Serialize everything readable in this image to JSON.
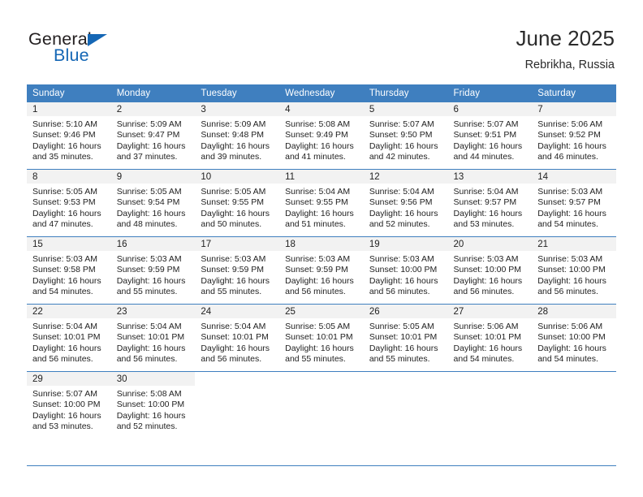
{
  "brand": {
    "word_one": "General",
    "word_two": "Blue",
    "flag_icon": "blue-triangle-flag",
    "accent_color": "#1567b5"
  },
  "header": {
    "title": "June 2025",
    "subtitle": "Rebrikha, Russia"
  },
  "theme": {
    "header_row_bg": "#3f7fbf",
    "daynum_strip_bg": "#f2f2f2",
    "grid_line": "#3f7fbf",
    "text": "#222222"
  },
  "weekdays": [
    "Sunday",
    "Monday",
    "Tuesday",
    "Wednesday",
    "Thursday",
    "Friday",
    "Saturday"
  ],
  "labels": {
    "sunrise_prefix": "Sunrise:",
    "sunset_prefix": "Sunset:",
    "daylight_prefix": "Daylight:"
  },
  "weeks": [
    [
      {
        "day": "1",
        "sunrise": "Sunrise: 5:10 AM",
        "sunset": "Sunset: 9:46 PM",
        "daylight_line1": "Daylight: 16 hours",
        "daylight_line2": "and 35 minutes."
      },
      {
        "day": "2",
        "sunrise": "Sunrise: 5:09 AM",
        "sunset": "Sunset: 9:47 PM",
        "daylight_line1": "Daylight: 16 hours",
        "daylight_line2": "and 37 minutes."
      },
      {
        "day": "3",
        "sunrise": "Sunrise: 5:09 AM",
        "sunset": "Sunset: 9:48 PM",
        "daylight_line1": "Daylight: 16 hours",
        "daylight_line2": "and 39 minutes."
      },
      {
        "day": "4",
        "sunrise": "Sunrise: 5:08 AM",
        "sunset": "Sunset: 9:49 PM",
        "daylight_line1": "Daylight: 16 hours",
        "daylight_line2": "and 41 minutes."
      },
      {
        "day": "5",
        "sunrise": "Sunrise: 5:07 AM",
        "sunset": "Sunset: 9:50 PM",
        "daylight_line1": "Daylight: 16 hours",
        "daylight_line2": "and 42 minutes."
      },
      {
        "day": "6",
        "sunrise": "Sunrise: 5:07 AM",
        "sunset": "Sunset: 9:51 PM",
        "daylight_line1": "Daylight: 16 hours",
        "daylight_line2": "and 44 minutes."
      },
      {
        "day": "7",
        "sunrise": "Sunrise: 5:06 AM",
        "sunset": "Sunset: 9:52 PM",
        "daylight_line1": "Daylight: 16 hours",
        "daylight_line2": "and 46 minutes."
      }
    ],
    [
      {
        "day": "8",
        "sunrise": "Sunrise: 5:05 AM",
        "sunset": "Sunset: 9:53 PM",
        "daylight_line1": "Daylight: 16 hours",
        "daylight_line2": "and 47 minutes."
      },
      {
        "day": "9",
        "sunrise": "Sunrise: 5:05 AM",
        "sunset": "Sunset: 9:54 PM",
        "daylight_line1": "Daylight: 16 hours",
        "daylight_line2": "and 48 minutes."
      },
      {
        "day": "10",
        "sunrise": "Sunrise: 5:05 AM",
        "sunset": "Sunset: 9:55 PM",
        "daylight_line1": "Daylight: 16 hours",
        "daylight_line2": "and 50 minutes."
      },
      {
        "day": "11",
        "sunrise": "Sunrise: 5:04 AM",
        "sunset": "Sunset: 9:55 PM",
        "daylight_line1": "Daylight: 16 hours",
        "daylight_line2": "and 51 minutes."
      },
      {
        "day": "12",
        "sunrise": "Sunrise: 5:04 AM",
        "sunset": "Sunset: 9:56 PM",
        "daylight_line1": "Daylight: 16 hours",
        "daylight_line2": "and 52 minutes."
      },
      {
        "day": "13",
        "sunrise": "Sunrise: 5:04 AM",
        "sunset": "Sunset: 9:57 PM",
        "daylight_line1": "Daylight: 16 hours",
        "daylight_line2": "and 53 minutes."
      },
      {
        "day": "14",
        "sunrise": "Sunrise: 5:03 AM",
        "sunset": "Sunset: 9:57 PM",
        "daylight_line1": "Daylight: 16 hours",
        "daylight_line2": "and 54 minutes."
      }
    ],
    [
      {
        "day": "15",
        "sunrise": "Sunrise: 5:03 AM",
        "sunset": "Sunset: 9:58 PM",
        "daylight_line1": "Daylight: 16 hours",
        "daylight_line2": "and 54 minutes."
      },
      {
        "day": "16",
        "sunrise": "Sunrise: 5:03 AM",
        "sunset": "Sunset: 9:59 PM",
        "daylight_line1": "Daylight: 16 hours",
        "daylight_line2": "and 55 minutes."
      },
      {
        "day": "17",
        "sunrise": "Sunrise: 5:03 AM",
        "sunset": "Sunset: 9:59 PM",
        "daylight_line1": "Daylight: 16 hours",
        "daylight_line2": "and 55 minutes."
      },
      {
        "day": "18",
        "sunrise": "Sunrise: 5:03 AM",
        "sunset": "Sunset: 9:59 PM",
        "daylight_line1": "Daylight: 16 hours",
        "daylight_line2": "and 56 minutes."
      },
      {
        "day": "19",
        "sunrise": "Sunrise: 5:03 AM",
        "sunset": "Sunset: 10:00 PM",
        "daylight_line1": "Daylight: 16 hours",
        "daylight_line2": "and 56 minutes."
      },
      {
        "day": "20",
        "sunrise": "Sunrise: 5:03 AM",
        "sunset": "Sunset: 10:00 PM",
        "daylight_line1": "Daylight: 16 hours",
        "daylight_line2": "and 56 minutes."
      },
      {
        "day": "21",
        "sunrise": "Sunrise: 5:03 AM",
        "sunset": "Sunset: 10:00 PM",
        "daylight_line1": "Daylight: 16 hours",
        "daylight_line2": "and 56 minutes."
      }
    ],
    [
      {
        "day": "22",
        "sunrise": "Sunrise: 5:04 AM",
        "sunset": "Sunset: 10:01 PM",
        "daylight_line1": "Daylight: 16 hours",
        "daylight_line2": "and 56 minutes."
      },
      {
        "day": "23",
        "sunrise": "Sunrise: 5:04 AM",
        "sunset": "Sunset: 10:01 PM",
        "daylight_line1": "Daylight: 16 hours",
        "daylight_line2": "and 56 minutes."
      },
      {
        "day": "24",
        "sunrise": "Sunrise: 5:04 AM",
        "sunset": "Sunset: 10:01 PM",
        "daylight_line1": "Daylight: 16 hours",
        "daylight_line2": "and 56 minutes."
      },
      {
        "day": "25",
        "sunrise": "Sunrise: 5:05 AM",
        "sunset": "Sunset: 10:01 PM",
        "daylight_line1": "Daylight: 16 hours",
        "daylight_line2": "and 55 minutes."
      },
      {
        "day": "26",
        "sunrise": "Sunrise: 5:05 AM",
        "sunset": "Sunset: 10:01 PM",
        "daylight_line1": "Daylight: 16 hours",
        "daylight_line2": "and 55 minutes."
      },
      {
        "day": "27",
        "sunrise": "Sunrise: 5:06 AM",
        "sunset": "Sunset: 10:01 PM",
        "daylight_line1": "Daylight: 16 hours",
        "daylight_line2": "and 54 minutes."
      },
      {
        "day": "28",
        "sunrise": "Sunrise: 5:06 AM",
        "sunset": "Sunset: 10:00 PM",
        "daylight_line1": "Daylight: 16 hours",
        "daylight_line2": "and 54 minutes."
      }
    ],
    [
      {
        "day": "29",
        "sunrise": "Sunrise: 5:07 AM",
        "sunset": "Sunset: 10:00 PM",
        "daylight_line1": "Daylight: 16 hours",
        "daylight_line2": "and 53 minutes."
      },
      {
        "day": "30",
        "sunrise": "Sunrise: 5:08 AM",
        "sunset": "Sunset: 10:00 PM",
        "daylight_line1": "Daylight: 16 hours",
        "daylight_line2": "and 52 minutes."
      },
      null,
      null,
      null,
      null,
      null
    ]
  ]
}
